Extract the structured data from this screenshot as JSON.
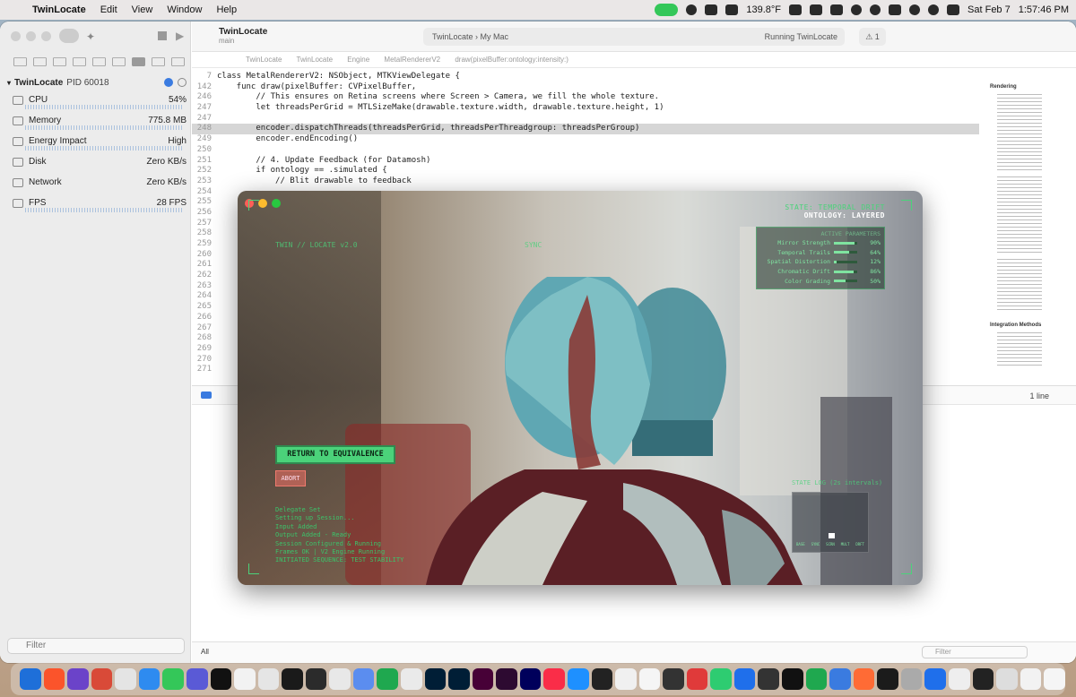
{
  "menubar": {
    "app": "TwinLocate",
    "items": [
      "Edit",
      "View",
      "Window",
      "Help"
    ],
    "temp": "139.8°F",
    "date": "Sat Feb 7",
    "time": "1:57:46 PM"
  },
  "sidebar": {
    "process": "TwinLocate",
    "pid": "PID 60018",
    "gauges": [
      {
        "label": "CPU",
        "value": "54%"
      },
      {
        "label": "Memory",
        "value": "775.8 MB"
      },
      {
        "label": "Energy Impact",
        "value": "High"
      },
      {
        "label": "Disk",
        "value": "Zero KB/s"
      },
      {
        "label": "Network",
        "value": "Zero KB/s"
      },
      {
        "label": "FPS",
        "value": "28 FPS"
      }
    ],
    "filter": "Filter"
  },
  "editor": {
    "project": "TwinLocate",
    "branch": "main",
    "scheme": "TwinLocate",
    "device": "My Mac",
    "run_status": "Running TwinLocate",
    "warnings": "1",
    "breadcrumbs": [
      "TwinLocate",
      "TwinLocate",
      "Engine",
      "MetalRendererV2",
      "draw(pixelBuffer:ontology:intensity:)"
    ],
    "lines": [
      {
        "n": "7",
        "t": "class MetalRendererV2: NSObject, MTKViewDelegate {"
      },
      {
        "n": "142",
        "t": "    func draw(pixelBuffer: CVPixelBuffer,"
      },
      {
        "n": "246",
        "t": "        // This ensures on Retina screens where Screen > Camera, we fill the whole texture."
      },
      {
        "n": "247",
        "t": "        let threadsPerGrid = MTLSizeMake(drawable.texture.width, drawable.texture.height, 1)"
      },
      {
        "n": "247",
        "t": ""
      },
      {
        "n": "248",
        "t": "        encoder.dispatchThreads(threadsPerGrid, threadsPerThreadgroup: threadsPerGroup)"
      },
      {
        "n": "249",
        "t": "        encoder.endEncoding()"
      },
      {
        "n": "250",
        "t": ""
      },
      {
        "n": "251",
        "t": "        // 4. Update Feedback (for Datamosh)"
      },
      {
        "n": "252",
        "t": "        if ontology == .simulated {"
      },
      {
        "n": "253",
        "t": "            // Blit drawable to feedback"
      },
      {
        "n": "254",
        "t": ""
      },
      {
        "n": "255",
        "t": ""
      },
      {
        "n": "256",
        "t": ""
      },
      {
        "n": "257",
        "t": ""
      },
      {
        "n": "258",
        "t": ""
      },
      {
        "n": "259",
        "t": ""
      },
      {
        "n": "260",
        "t": ""
      },
      {
        "n": "261",
        "t": ""
      },
      {
        "n": "262",
        "t": ""
      },
      {
        "n": "263",
        "t": ""
      },
      {
        "n": "264",
        "t": ""
      },
      {
        "n": "265",
        "t": ""
      },
      {
        "n": "266",
        "t": ""
      },
      {
        "n": "267",
        "t": ""
      },
      {
        "n": "268",
        "t": ""
      },
      {
        "n": "269",
        "t": ""
      },
      {
        "n": "270",
        "t": ""
      },
      {
        "n": "271",
        "t": ""
      }
    ],
    "minimap": {
      "h1": "Rendering",
      "h2": "Integration Methods"
    },
    "debug_lines": "1 line",
    "scope": "All",
    "filter": "Filter"
  },
  "app": {
    "status1": "STATE: TEMPORAL DRIFT",
    "status2": "ONTOLOGY: LAYERED",
    "panel_title": "ACTIVE PARAMETERS",
    "params": [
      {
        "label": "Mirror Strength",
        "value": "90%",
        "level": 0.9
      },
      {
        "label": "Temporal Trails",
        "value": "64%",
        "level": 0.64
      },
      {
        "label": "Spatial Distortion",
        "value": "12%",
        "level": 0.12
      },
      {
        "label": "Chromatic Drift",
        "value": "86%",
        "level": 0.86
      },
      {
        "label": "Color Grading",
        "value": "50%",
        "level": 0.5
      }
    ],
    "twin_label": "TWIN // LOCATE v2.0",
    "twin_label2": "SYNC",
    "return_button": "RETURN TO EQUIVALENCE",
    "abort_button": "ABORT",
    "log": [
      "Delegate Set",
      "Setting up Session...",
      "Input Added",
      "Output Added - Ready",
      "Session Configured & Running",
      "Frames OK | V2 Engine Running",
      "INITIATED SEQUENCE: TEST STABILITY"
    ],
    "state_log_title": "STATE LOG (2s intervals)",
    "state_log_labels": [
      "BASE",
      "SYNC",
      "SCRN",
      "MULT",
      "DRFT"
    ]
  }
}
